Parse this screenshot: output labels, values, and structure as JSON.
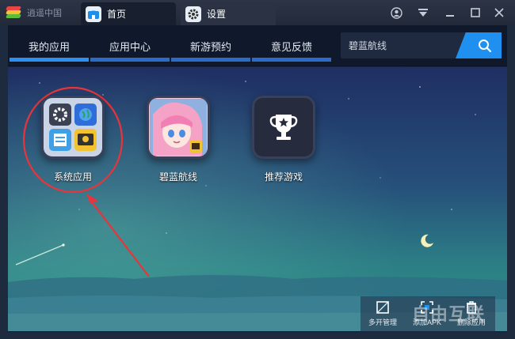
{
  "titlebar": {
    "brand": "逍遥中国",
    "tabs": [
      {
        "label": "首页",
        "icon": "home-icon"
      },
      {
        "label": "设置",
        "icon": "gear-icon"
      }
    ],
    "controls": [
      "user-icon",
      "dropdown-icon",
      "minimize-icon",
      "maximize-icon",
      "close-icon"
    ]
  },
  "nav": {
    "tabs": [
      {
        "label": "我的应用",
        "active": true
      },
      {
        "label": "应用中心",
        "active": false
      },
      {
        "label": "新游预约",
        "active": false
      },
      {
        "label": "意见反馈",
        "active": false
      }
    ],
    "search": {
      "value": "碧蓝航线"
    }
  },
  "apps": [
    {
      "label": "系统应用",
      "icon": "system-apps-folder-icon"
    },
    {
      "label": "碧蓝航线",
      "icon": "azur-lane-game-icon"
    },
    {
      "label": "推荐游戏",
      "icon": "trophy-icon"
    }
  ],
  "bottom_bar": [
    {
      "label": "多开管理",
      "icon": "multi-instance-icon"
    },
    {
      "label": "添加APK",
      "icon": "add-apk-icon"
    },
    {
      "label": "删除应用",
      "icon": "trash-icon"
    }
  ],
  "watermark": "自由互联",
  "colors": {
    "accent": "#1f8ff0",
    "annotation": "#e8343a",
    "nav_bg": "#10192b"
  }
}
